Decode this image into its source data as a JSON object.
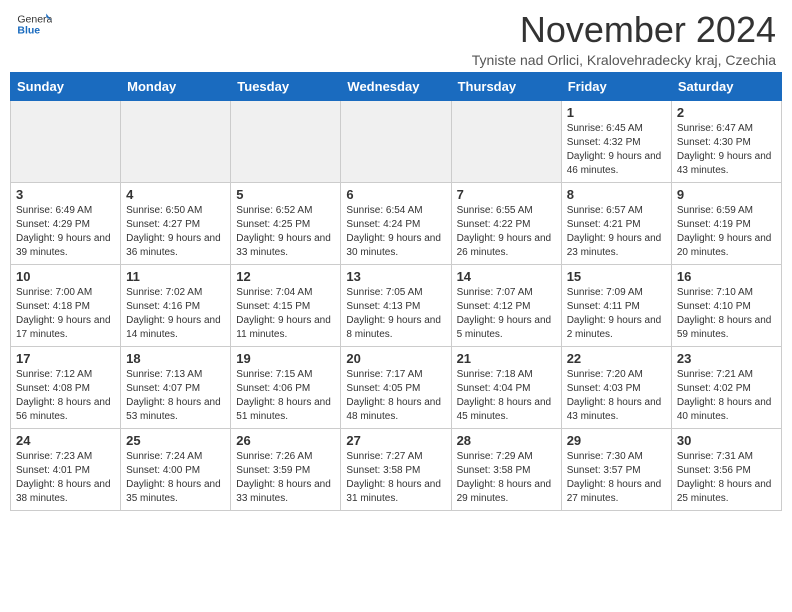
{
  "logo": {
    "text_general": "General",
    "text_blue": "Blue"
  },
  "title": {
    "month_year": "November 2024",
    "location": "Tyniste nad Orlici, Kralovehradecky kraj, Czechia"
  },
  "headers": [
    "Sunday",
    "Monday",
    "Tuesday",
    "Wednesday",
    "Thursday",
    "Friday",
    "Saturday"
  ],
  "weeks": [
    [
      {
        "day": "",
        "info": ""
      },
      {
        "day": "",
        "info": ""
      },
      {
        "day": "",
        "info": ""
      },
      {
        "day": "",
        "info": ""
      },
      {
        "day": "",
        "info": ""
      },
      {
        "day": "1",
        "info": "Sunrise: 6:45 AM\nSunset: 4:32 PM\nDaylight: 9 hours and 46 minutes."
      },
      {
        "day": "2",
        "info": "Sunrise: 6:47 AM\nSunset: 4:30 PM\nDaylight: 9 hours and 43 minutes."
      }
    ],
    [
      {
        "day": "3",
        "info": "Sunrise: 6:49 AM\nSunset: 4:29 PM\nDaylight: 9 hours and 39 minutes."
      },
      {
        "day": "4",
        "info": "Sunrise: 6:50 AM\nSunset: 4:27 PM\nDaylight: 9 hours and 36 minutes."
      },
      {
        "day": "5",
        "info": "Sunrise: 6:52 AM\nSunset: 4:25 PM\nDaylight: 9 hours and 33 minutes."
      },
      {
        "day": "6",
        "info": "Sunrise: 6:54 AM\nSunset: 4:24 PM\nDaylight: 9 hours and 30 minutes."
      },
      {
        "day": "7",
        "info": "Sunrise: 6:55 AM\nSunset: 4:22 PM\nDaylight: 9 hours and 26 minutes."
      },
      {
        "day": "8",
        "info": "Sunrise: 6:57 AM\nSunset: 4:21 PM\nDaylight: 9 hours and 23 minutes."
      },
      {
        "day": "9",
        "info": "Sunrise: 6:59 AM\nSunset: 4:19 PM\nDaylight: 9 hours and 20 minutes."
      }
    ],
    [
      {
        "day": "10",
        "info": "Sunrise: 7:00 AM\nSunset: 4:18 PM\nDaylight: 9 hours and 17 minutes."
      },
      {
        "day": "11",
        "info": "Sunrise: 7:02 AM\nSunset: 4:16 PM\nDaylight: 9 hours and 14 minutes."
      },
      {
        "day": "12",
        "info": "Sunrise: 7:04 AM\nSunset: 4:15 PM\nDaylight: 9 hours and 11 minutes."
      },
      {
        "day": "13",
        "info": "Sunrise: 7:05 AM\nSunset: 4:13 PM\nDaylight: 9 hours and 8 minutes."
      },
      {
        "day": "14",
        "info": "Sunrise: 7:07 AM\nSunset: 4:12 PM\nDaylight: 9 hours and 5 minutes."
      },
      {
        "day": "15",
        "info": "Sunrise: 7:09 AM\nSunset: 4:11 PM\nDaylight: 9 hours and 2 minutes."
      },
      {
        "day": "16",
        "info": "Sunrise: 7:10 AM\nSunset: 4:10 PM\nDaylight: 8 hours and 59 minutes."
      }
    ],
    [
      {
        "day": "17",
        "info": "Sunrise: 7:12 AM\nSunset: 4:08 PM\nDaylight: 8 hours and 56 minutes."
      },
      {
        "day": "18",
        "info": "Sunrise: 7:13 AM\nSunset: 4:07 PM\nDaylight: 8 hours and 53 minutes."
      },
      {
        "day": "19",
        "info": "Sunrise: 7:15 AM\nSunset: 4:06 PM\nDaylight: 8 hours and 51 minutes."
      },
      {
        "day": "20",
        "info": "Sunrise: 7:17 AM\nSunset: 4:05 PM\nDaylight: 8 hours and 48 minutes."
      },
      {
        "day": "21",
        "info": "Sunrise: 7:18 AM\nSunset: 4:04 PM\nDaylight: 8 hours and 45 minutes."
      },
      {
        "day": "22",
        "info": "Sunrise: 7:20 AM\nSunset: 4:03 PM\nDaylight: 8 hours and 43 minutes."
      },
      {
        "day": "23",
        "info": "Sunrise: 7:21 AM\nSunset: 4:02 PM\nDaylight: 8 hours and 40 minutes."
      }
    ],
    [
      {
        "day": "24",
        "info": "Sunrise: 7:23 AM\nSunset: 4:01 PM\nDaylight: 8 hours and 38 minutes."
      },
      {
        "day": "25",
        "info": "Sunrise: 7:24 AM\nSunset: 4:00 PM\nDaylight: 8 hours and 35 minutes."
      },
      {
        "day": "26",
        "info": "Sunrise: 7:26 AM\nSunset: 3:59 PM\nDaylight: 8 hours and 33 minutes."
      },
      {
        "day": "27",
        "info": "Sunrise: 7:27 AM\nSunset: 3:58 PM\nDaylight: 8 hours and 31 minutes."
      },
      {
        "day": "28",
        "info": "Sunrise: 7:29 AM\nSunset: 3:58 PM\nDaylight: 8 hours and 29 minutes."
      },
      {
        "day": "29",
        "info": "Sunrise: 7:30 AM\nSunset: 3:57 PM\nDaylight: 8 hours and 27 minutes."
      },
      {
        "day": "30",
        "info": "Sunrise: 7:31 AM\nSunset: 3:56 PM\nDaylight: 8 hours and 25 minutes."
      }
    ]
  ]
}
